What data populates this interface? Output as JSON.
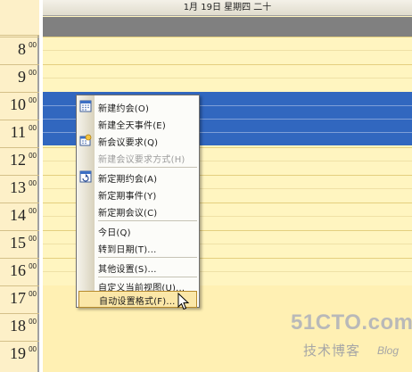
{
  "calendar": {
    "date_header": "1月 19日 星期四 二十",
    "minutes_label": "00",
    "hours": [
      "8",
      "9",
      "10",
      "11",
      "12",
      "13",
      "14",
      "15",
      "16",
      "17",
      "18",
      "19"
    ]
  },
  "context_menu": {
    "items": [
      {
        "label": "新建约会(O)",
        "icon": "appointment-icon",
        "disabled": false
      },
      {
        "label": "新建全天事件(E)",
        "icon": "",
        "disabled": false
      },
      {
        "label": "新会议要求(Q)",
        "icon": "meeting-request-icon",
        "disabled": false
      },
      {
        "label": "新建会议要求方式(H)",
        "icon": "",
        "disabled": true
      },
      {
        "label": "新定期约会(A)",
        "icon": "recurring-appointment-icon",
        "disabled": false
      },
      {
        "label": "新定期事件(Y)",
        "icon": "",
        "disabled": false
      },
      {
        "label": "新定期会议(C)",
        "icon": "",
        "disabled": false
      },
      {
        "label": "今日(Q)",
        "icon": "",
        "disabled": false
      },
      {
        "label": "转到日期(T)...",
        "icon": "",
        "disabled": false
      },
      {
        "label": "其他设置(S)...",
        "icon": "",
        "disabled": false
      },
      {
        "label": "自定义当前视图(U)...",
        "icon": "",
        "disabled": false
      },
      {
        "label": "自动设置格式(F)...",
        "icon": "",
        "disabled": false,
        "hover": true
      }
    ]
  },
  "watermark": {
    "logo": "51CTO.com",
    "subtitle": "技术博客",
    "blog": "Blog"
  }
}
